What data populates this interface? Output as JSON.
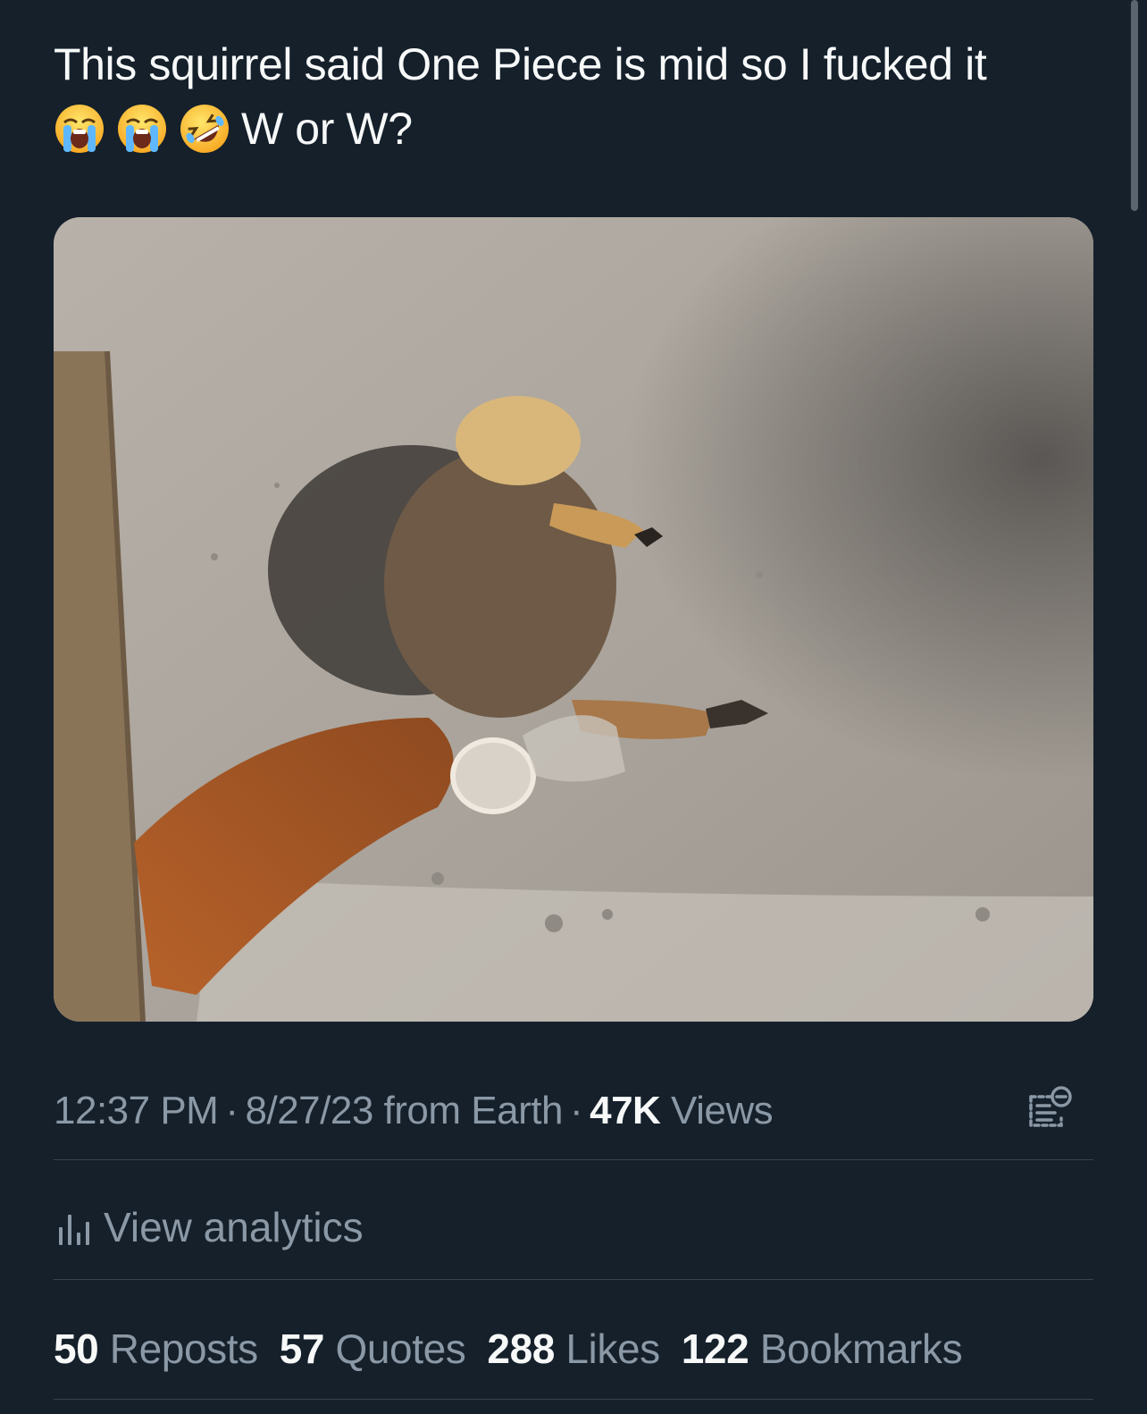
{
  "tweet": {
    "text_line1": "This squirrel said One Piece is mid so I fucked it",
    "text_line2": "W or W?",
    "emojis": [
      "loudly-crying-face",
      "loudly-crying-face",
      "rolling-on-floor-laughing"
    ]
  },
  "media": {
    "image_subject": "squirrel lying on sandy pavement"
  },
  "meta": {
    "time": "12:37 PM",
    "date": "8/27/23",
    "source": "from Earth",
    "separator": "·",
    "views_count": "47K",
    "views_label": "Views",
    "icon": "community-note-icon"
  },
  "analytics": {
    "label": "View analytics",
    "icon": "bar-chart-icon"
  },
  "stats": [
    {
      "count": "50",
      "label": "Reposts"
    },
    {
      "count": "57",
      "label": "Quotes"
    },
    {
      "count": "288",
      "label": "Likes"
    },
    {
      "count": "122",
      "label": "Bookmarks"
    }
  ],
  "colors": {
    "background": "#15202b",
    "primary_text": "#f7f9f9",
    "secondary_text": "#8b98a5",
    "divider": "#38444d"
  }
}
